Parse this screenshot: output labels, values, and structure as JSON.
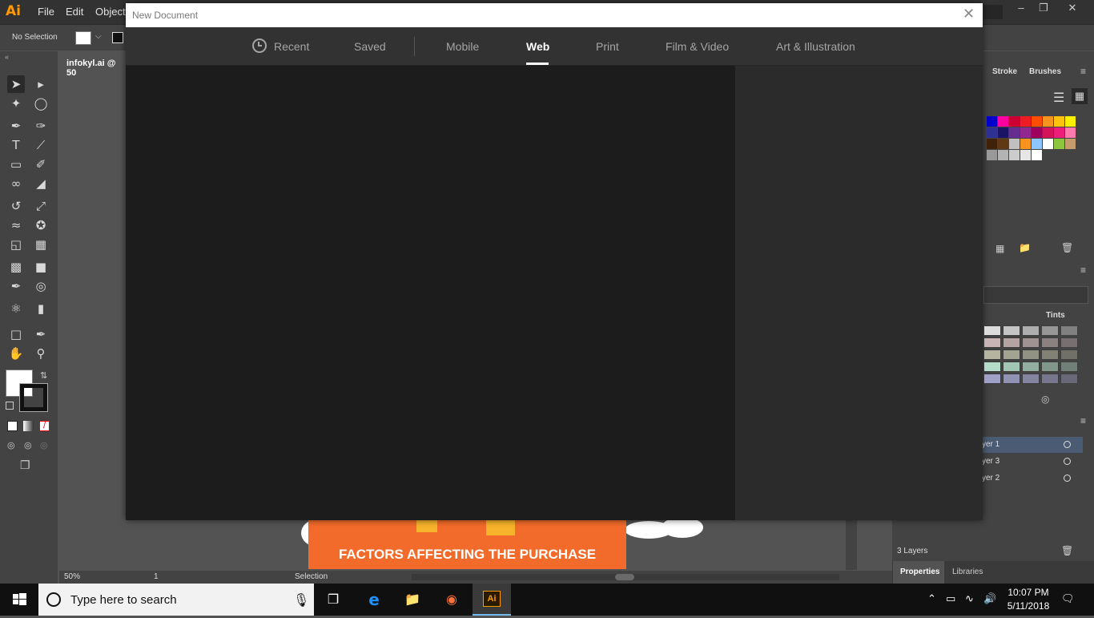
{
  "app": {
    "logo": "Ai",
    "menu": [
      "File",
      "Edit",
      "Object"
    ],
    "window_controls": [
      "–",
      "❐",
      "✕"
    ]
  },
  "control_bar": {
    "selection_label": "No Selection"
  },
  "document": {
    "tab_title": "infokyl.ai @ 50"
  },
  "artboard": {
    "heading": "FACTORS AFFECTING THE PURCHASE"
  },
  "statusbar": {
    "zoom": "50%",
    "page": "1",
    "mode": "Selection"
  },
  "right_panel": {
    "tabs": [
      "Stroke",
      "Brushes"
    ],
    "tints_label": "Tints",
    "layers": [
      {
        "name": "yer 1",
        "selected": true
      },
      {
        "name": "yer 3",
        "selected": false
      },
      {
        "name": "yer 2",
        "selected": false
      }
    ],
    "layers_count": "3 Layers",
    "bottom_tabs": [
      "Properties",
      "Libraries"
    ],
    "swatch_colors": [
      "#0000cc",
      "#ff00a0",
      "#cc0033",
      "#ee1c24",
      "#ff4d00",
      "#f7941d",
      "#ffc20e",
      "#fff200",
      "#2e3192",
      "#1b1464",
      "#662d91",
      "#92278f",
      "#9e005d",
      "#d4145a",
      "#ed1e79",
      "#ff7bac",
      "#42210b",
      "#603813",
      "#c0c0c0",
      "#f7931e",
      "#8dc6ff",
      "#ffffff",
      "#8cc63f",
      "#c69c6d",
      "#999999",
      "#b3b3b3",
      "#cccccc",
      "#e6e6e6",
      "#ffffff"
    ],
    "tint_colors": [
      "#dcdcdc",
      "#c8b4b4",
      "#b4b4a0",
      "#b4dcc8",
      "#a0a0c8"
    ]
  },
  "dialog": {
    "title": "New Document",
    "close": "✕",
    "tabs": [
      "Recent",
      "Saved",
      "Mobile",
      "Web",
      "Print",
      "Film & Video",
      "Art & Illustration"
    ],
    "active_tab": "Web"
  },
  "taskbar": {
    "search_placeholder": "Type here to search",
    "time": "10:07 PM",
    "date": "5/11/2018"
  }
}
